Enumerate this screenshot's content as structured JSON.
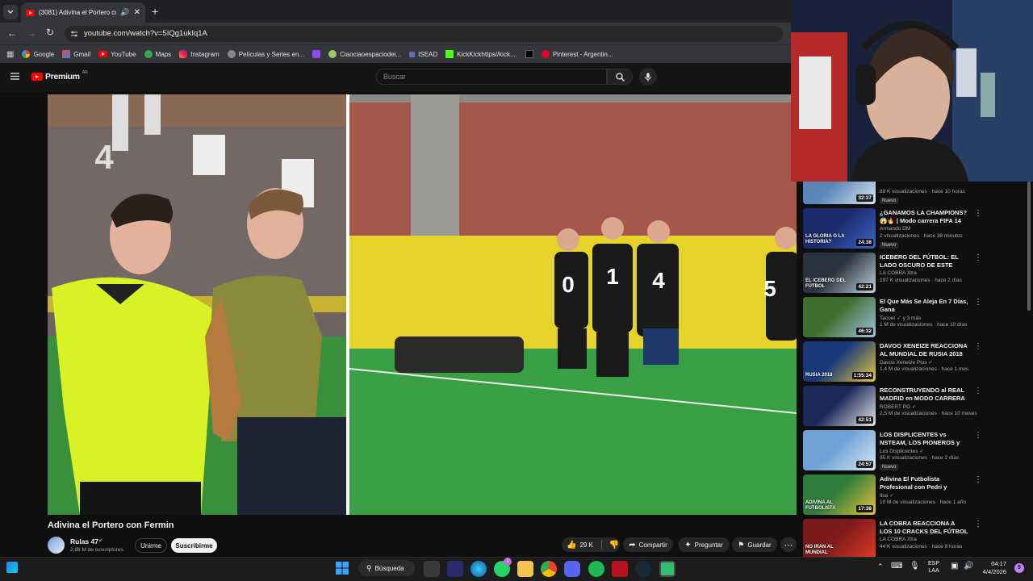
{
  "browser": {
    "tab_title": "(3081) Adivina el Portero co",
    "url": "youtube.com/watch?v=5IQg1ukIq1A",
    "bookmarks": [
      "Google",
      "Gmail",
      "YouTube",
      "Maps",
      "Instagram",
      "Películas y Series en...",
      "",
      "Ciaociaoespaciodei...",
      "ISEAD",
      "KickKickhttps//kick....",
      "",
      "Pinterest - Argentin..."
    ]
  },
  "youtube": {
    "logo_text": "Premium",
    "logo_region": "AR",
    "search_placeholder": "Buscar"
  },
  "video": {
    "title": "Adivina el Portero con Fermin",
    "channel": "Rulas 47",
    "subscribers": "2,98 M de suscriptores",
    "join_label": "Unirme",
    "subscribe_label": "Suscribirme",
    "likes": "29 K",
    "share_label": "Compartir",
    "ask_label": "Preguntar",
    "save_label": "Guardar",
    "shirt_numbers": [
      "0",
      "1",
      "4",
      "5"
    ],
    "wall_text": "4"
  },
  "recommendations": [
    {
      "title": "",
      "channel": "",
      "meta": "88 K visualizaciones · hace 10 horas",
      "badge": "Nuevo",
      "duration": "32:37",
      "colors": [
        "#5b86b8",
        "#d8e4ef"
      ]
    },
    {
      "title": "¿GANAMOS LA CHAMPIONS? 😱🔥 | Modo carrera FIFA 14 |...",
      "channel": "Armando DM",
      "meta": "2 visualizaciones · hace 38 minutos",
      "badge": "Nuevo",
      "duration": "24:38",
      "thumb_text": "LA GLORIA O LA HISTORIA?",
      "colors": [
        "#1b2a6b",
        "#3a64c8"
      ]
    },
    {
      "title": "ICEBERG DEL FÚTBOL: EL LADO OSCURO DE ESTE DEPORTE...",
      "channel": "LA COBRA Xtra",
      "meta": "197 K visualizaciones · hace 2 días",
      "badge": "",
      "duration": "42:21",
      "thumb_text": "EL ICEBERG DEL FÚTBOL",
      "colors": [
        "#2a3440",
        "#c2d3e0"
      ]
    },
    {
      "title": "El Que Más Se Aleja En 7 Días, Gana",
      "channel": "Tacoer ✓ y 3 más",
      "meta": "1 M de visualizaciones · hace 10 días",
      "badge": "",
      "duration": "46:32",
      "colors": [
        "#3f6f2f",
        "#9fc1e2"
      ]
    },
    {
      "title": "DAVOO XENEIZE REACCIONA AL MUNDIAL DE RUSIA 2018 -...",
      "channel": "Davoo Xeneize Plus ✓",
      "meta": "1,4 M de visualizaciones · hace 1 mes",
      "badge": "",
      "duration": "1:55:34",
      "thumb_text": "RUSIA 2018",
      "colors": [
        "#193a7a",
        "#e8c93a"
      ]
    },
    {
      "title": "RECONSTRUYENDO al REAL MADRID en MODO CARRERA",
      "channel": "ROBERT PG ✓",
      "meta": "2,5 M de visualizaciones · hace 10 meses",
      "badge": "",
      "duration": "42:51",
      "colors": [
        "#1c2a5a",
        "#e7e7e7"
      ]
    },
    {
      "title": "LOS DISPLICENTES vs NSTEAM, LOS PIONEROS y AL...",
      "channel": "Los Displicentes ✓",
      "meta": "95 K visualizaciones · hace 2 días",
      "badge": "Nuevo",
      "duration": "24:57",
      "colors": [
        "#6fa2d6",
        "#d9e8f5"
      ]
    },
    {
      "title": "Adivina El Futbolista Profesional con Pedri y Ferran...",
      "channel": "Ibai ✓",
      "meta": "10 M de visualizaciones · hace 1 año",
      "badge": "",
      "duration": "17:38",
      "thumb_text": "ADIVINA AL FUTBOLISTA",
      "colors": [
        "#2f7d3a",
        "#e5c43d"
      ]
    },
    {
      "title": "LA COBRA REACCIONA A LOS 10 CRACKS DEL FÚTBOL QUE...",
      "channel": "LA COBRA Xtra",
      "meta": "44 K visualizaciones · hace 8 horas",
      "badge": "",
      "duration": "",
      "thumb_text": "NO IRAN AL MUNDIAL",
      "colors": [
        "#7a1a1a",
        "#e03a2a"
      ]
    }
  ],
  "taskbar": {
    "search_label": "Búsqueda",
    "whatsapp_badge": "1",
    "lang_top": "ESP",
    "lang_bottom": "LAA",
    "time": "04:17",
    "date": "4/4/2026",
    "notif_count": "5"
  },
  "colors": {
    "accent": "#ff0000",
    "bg": "#0f0f0f",
    "chrome": "#35363a"
  }
}
